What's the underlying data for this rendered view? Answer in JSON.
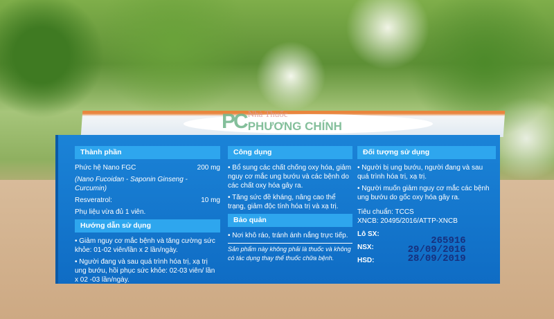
{
  "watermark": {
    "small": "Nhà Thuốc",
    "big": "PHƯƠNG CHÍNH",
    "logo": "PC"
  },
  "col1": {
    "h1": "Thành phần",
    "ing1_name": "Phức hệ Nano FGC",
    "ing1_dose": "200 mg",
    "ing1_sub": "(Nano Fucoidan - Saponin Ginseng - Curcumin)",
    "ing2_name": "Resveratrol:",
    "ing2_dose": "10 mg",
    "excipient": "Phụ liệu vừa đủ 1 viên.",
    "h2": "Hướng dẫn sử dụng",
    "use1": "• Giảm nguy cơ mắc bệnh và tăng cường sức khỏe: 01-02 viên/lần x 2 lần/ngày.",
    "use2": "• Người đang và sau quá trình hóa trị, xạ trị ung bướu, hồi phục sức khỏe: 02-03 viên/ lần x 02 -03 lần/ngày."
  },
  "col2": {
    "h1": "Công dụng",
    "b1": "• Bổ sung các chất chống oxy hóa, giảm nguy cơ mắc ung bướu và các bệnh do các chất oxy hóa gây ra.",
    "b2": "• Tăng sức đề kháng, nâng cao thể trạng, giảm độc tính hóa trị và xạ trị.",
    "h2": "Bảo quản",
    "storage": "• Nơi khô ráo, tránh ánh nắng trực tiếp.",
    "note": "Sản phẩm này không phải là thuốc và không có tác dụng thay thế thuốc chữa bệnh."
  },
  "col3": {
    "h1": "Đối tượng sử dụng",
    "b1": "• Người bị ung bướu, người đang và sau quá trình hóa trị, xạ trị.",
    "b2": "• Người muốn giảm nguy cơ mắc các bệnh ung bướu do gốc oxy hóa gây ra.",
    "standard": "Tiêu chuẩn: TCCS",
    "xncb": "XNCB: 20495/2016/ATTP-XNCB",
    "lot_label": "Lô SX:",
    "nsx_label": "NSX:",
    "hsd_label": "HSD:",
    "lot": "265916",
    "nsx": "29/09/2016",
    "hsd": "28/09/2019"
  }
}
